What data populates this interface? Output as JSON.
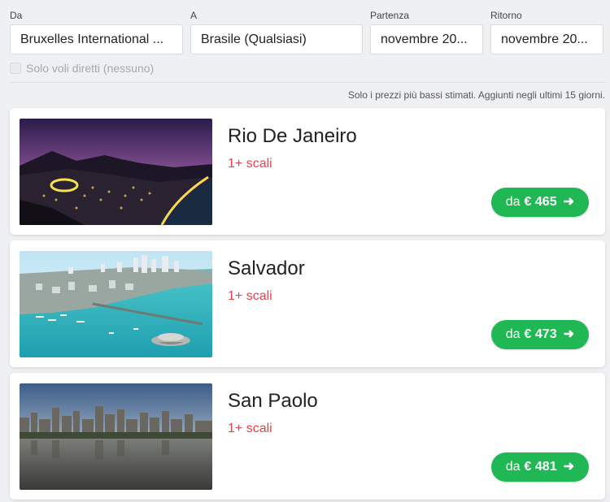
{
  "search": {
    "from_label": "Da",
    "from_value": "Bruxelles International ...",
    "to_label": "A",
    "to_value": "Brasile (Qualsiasi)",
    "depart_label": "Partenza",
    "depart_value": "novembre 20...",
    "return_label": "Ritorno",
    "return_value": "novembre 20...",
    "direct_only_label": "Solo voli diretti (nessuno)",
    "direct_only_checked": false
  },
  "note": "Solo i prezzi più bassi stimati. Aggiunti negli ultimi 15 giorni.",
  "results": [
    {
      "city": "Rio De Janeiro",
      "stops": "1+ scali",
      "price_prefix": "da",
      "price": "€ 465",
      "price_arrow": "➜"
    },
    {
      "city": "Salvador",
      "stops": "1+ scali",
      "price_prefix": "da",
      "price": "€ 473",
      "price_arrow": "➜"
    },
    {
      "city": "San Paolo",
      "stops": "1+ scali",
      "price_prefix": "da",
      "price": "€ 481",
      "price_arrow": "➜"
    }
  ],
  "colors": {
    "price_button": "#20b755",
    "stops_text": "#e8414b"
  }
}
